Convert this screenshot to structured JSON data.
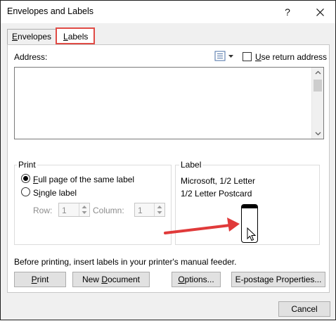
{
  "window": {
    "title": "Envelopes and Labels",
    "help_glyph": "?",
    "close_icon": "close-icon"
  },
  "tabs": [
    {
      "label": "Envelopes",
      "hotkey_index": 0
    },
    {
      "label": "Labels",
      "hotkey_index": 0,
      "selected": true,
      "highlight_color": "#e04b45"
    }
  ],
  "address": {
    "label": "Address:",
    "value": "",
    "book_icon": "address-book-icon",
    "use_return_label": "Use return address",
    "use_return_checked": false
  },
  "print_group": {
    "title": "Print",
    "full_page_label": "Full page of the same label",
    "full_page_selected": true,
    "single_label": "Single label",
    "single_selected": false,
    "row_label": "Row:",
    "row_value": "1",
    "column_label": "Column:",
    "column_value": "1"
  },
  "label_group": {
    "title": "Label",
    "line1": "Microsoft, 1/2 Letter",
    "line2": "1/2 Letter Postcard",
    "preview_icon": "label-preview-icon"
  },
  "instruction": "Before printing, insert labels in your printer's manual feeder.",
  "buttons": {
    "print": "Print",
    "new_document": "New Document",
    "options": "Options...",
    "epostage": "E-postage Properties...",
    "cancel": "Cancel"
  },
  "annotation": {
    "arrow_color": "#e03a3a"
  }
}
